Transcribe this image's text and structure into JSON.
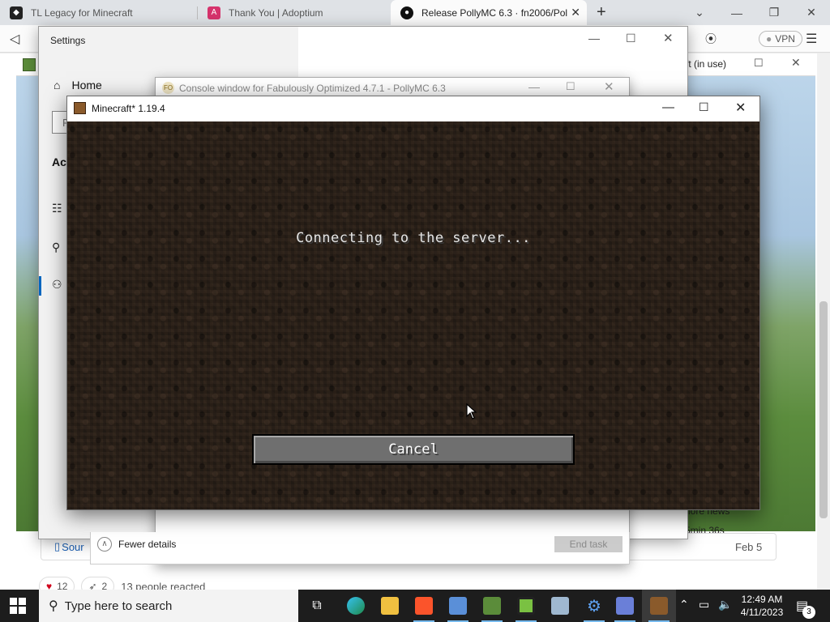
{
  "browser": {
    "tabs": [
      {
        "title": "TL Legacy for Minecraft",
        "active": false
      },
      {
        "title": "Thank You | Adoptium",
        "active": false
      },
      {
        "title": "Release PollyMC 6.3 · fn2006/Poll",
        "active": true
      }
    ],
    "new_tab_symbol": "+",
    "vpn_label": "VPN",
    "dropdown_text": "ft (in use)",
    "page": {
      "more_news": "lore news",
      "time_ago": "5min 36s",
      "source_link": "Sour",
      "date": "Feb 5",
      "reactions": [
        {
          "icon": "heart-icon",
          "count": "12"
        },
        {
          "icon": "rocket-icon",
          "count": "2"
        }
      ],
      "reacted_text": "13 people reacted"
    }
  },
  "settings": {
    "title": "Settings",
    "home_label": "Home",
    "search_partial": "F",
    "section_partial": "Acc"
  },
  "console": {
    "title": "Console window for Fabulously Optimized 4.7.1 - PollyMC 6.3",
    "fewer_details": "Fewer details",
    "end_task": "End task"
  },
  "minecraft": {
    "title": "Minecraft* 1.19.4",
    "status": "Connecting to the server...",
    "cancel_button": "Cancel"
  },
  "taskbar": {
    "search_placeholder": "Type here to search",
    "time": "12:49 AM",
    "date": "4/11/2023",
    "notification_count": "3"
  }
}
